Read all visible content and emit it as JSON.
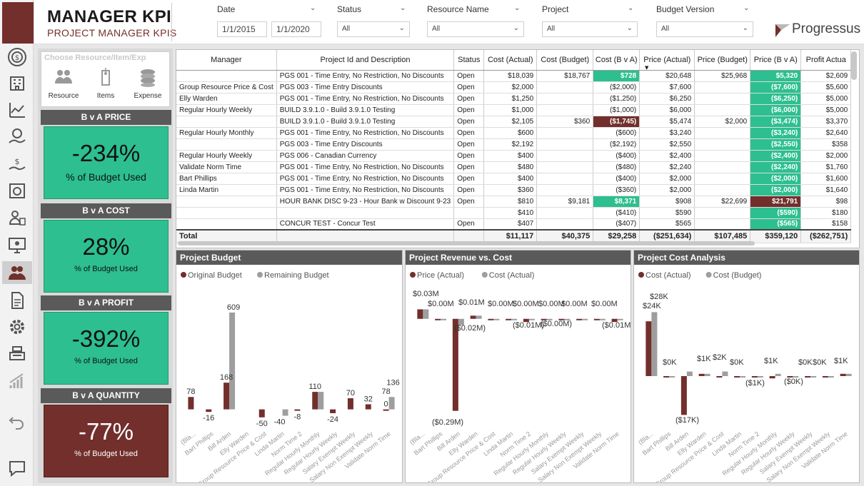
{
  "header": {
    "title": "MANAGER KPI",
    "subtitle": "PROJECT MANAGER KPIS",
    "logo_text": "Progressus"
  },
  "filters": {
    "date": {
      "label": "Date",
      "from": "1/1/2015",
      "to": "1/1/2020"
    },
    "status": {
      "label": "Status",
      "value": "All"
    },
    "resource": {
      "label": "Resource Name",
      "value": "All"
    },
    "project": {
      "label": "Project",
      "value": "All"
    },
    "budget_version": {
      "label": "Budget Version",
      "value": "All"
    }
  },
  "chooser": {
    "title": "Choose Resource/Item/Exp",
    "items": [
      {
        "label": "Resource",
        "icon": "people-icon"
      },
      {
        "label": "Items",
        "icon": "tag-icon"
      },
      {
        "label": "Expense",
        "icon": "coins-icon"
      }
    ]
  },
  "kpis": [
    {
      "title": "B v A PRICE",
      "value": "-234%",
      "caption": "% of Budget Used",
      "status": "green"
    },
    {
      "title": "B v A COST",
      "value": "28%",
      "caption": "% of Budget Used",
      "status": "green"
    },
    {
      "title": "B v A PROFIT",
      "value": "-392%",
      "caption": "% of Budget Used",
      "status": "green"
    },
    {
      "title": "B v A QUANTITY",
      "value": "-77%",
      "caption": "% of Budget Used",
      "status": "red"
    }
  ],
  "table": {
    "columns": [
      "Manager",
      "Project Id and Description",
      "Status",
      "Cost (Actual)",
      "Cost (Budget)",
      "Cost (B v A)",
      "Price (Actual)",
      "Price (Budget)",
      "Price (B v A)",
      "Profit Actua"
    ],
    "rows": [
      [
        "",
        "PGS 001 - Time Entry, No Restriction, No Discounts",
        "Open",
        "$18,039",
        "$18,767",
        "$728",
        "$20,648",
        "$25,968",
        "$5,320",
        "$2,609"
      ],
      [
        "Group Resource Price & Cost",
        "PGS 003 - Time Entry Discounts",
        "Open",
        "$2,000",
        "",
        "($2,000)",
        "$7,600",
        "",
        "($7,600)",
        "$5,600"
      ],
      [
        "Elly Warden",
        "PGS 001 - Time Entry, No Restriction, No Discounts",
        "Open",
        "$1,250",
        "",
        "($1,250)",
        "$6,250",
        "",
        "($6,250)",
        "$5,000"
      ],
      [
        "Regular Hourly Weekly",
        "BUILD 3.9.1.0 - Build 3.9.1.0 Testing",
        "Open",
        "$1,000",
        "",
        "($1,000)",
        "$6,000",
        "",
        "($6,000)",
        "$5,000"
      ],
      [
        "",
        "BUILD 3.9.1.0 - Build 3.9.1.0 Testing",
        "Open",
        "$2,105",
        "$360",
        "($1,745)",
        "$5,474",
        "$2,000",
        "($3,474)",
        "$3,370"
      ],
      [
        "Regular Hourly Monthly",
        "PGS 001 - Time Entry, No Restriction, No Discounts",
        "Open",
        "$600",
        "",
        "($600)",
        "$3,240",
        "",
        "($3,240)",
        "$2,640"
      ],
      [
        "",
        "PGS 003 - Time Entry Discounts",
        "Open",
        "$2,192",
        "",
        "($2,192)",
        "$2,550",
        "",
        "($2,550)",
        "$358"
      ],
      [
        "Regular Hourly Weekly",
        "PGS 006 - Canadian Currency",
        "Open",
        "$400",
        "",
        "($400)",
        "$2,400",
        "",
        "($2,400)",
        "$2,000"
      ],
      [
        "Validate Norm Time",
        "PGS 001 - Time Entry, No Restriction, No Discounts",
        "Open",
        "$480",
        "",
        "($480)",
        "$2,240",
        "",
        "($2,240)",
        "$1,760"
      ],
      [
        "Bart Phillips",
        "PGS 001 - Time Entry, No Restriction, No Discounts",
        "Open",
        "$400",
        "",
        "($400)",
        "$2,000",
        "",
        "($2,000)",
        "$1,600"
      ],
      [
        "Linda Martin",
        "PGS 001 - Time Entry, No Restriction, No Discounts",
        "Open",
        "$360",
        "",
        "($360)",
        "$2,000",
        "",
        "($2,000)",
        "$1,640"
      ],
      [
        "",
        "HOUR BANK DISC 9-23 - Hour Bank w Discount 9-23",
        "Open",
        "$810",
        "$9,181",
        "$8,371",
        "$908",
        "$22,699",
        "$21,791",
        "$98"
      ],
      [
        "",
        "",
        "",
        "$410",
        "",
        "($410)",
        "$590",
        "",
        "($590)",
        "$180"
      ],
      [
        "",
        "CONCUR TEST - Concur Test",
        "Open",
        "$407",
        "",
        "($407)",
        "$565",
        "",
        "($565)",
        "$158"
      ]
    ],
    "cell_status": [
      [
        "",
        "",
        "",
        "",
        "",
        "g",
        "",
        "",
        "g",
        ""
      ],
      [
        "",
        "",
        "",
        "",
        "",
        "",
        "",
        "",
        "g",
        ""
      ],
      [
        "",
        "",
        "",
        "",
        "",
        "",
        "",
        "",
        "g",
        ""
      ],
      [
        "",
        "",
        "",
        "",
        "",
        "",
        "",
        "",
        "g",
        ""
      ],
      [
        "",
        "",
        "",
        "",
        "",
        "r",
        "",
        "",
        "g",
        ""
      ],
      [
        "",
        "",
        "",
        "",
        "",
        "",
        "",
        "",
        "g",
        ""
      ],
      [
        "",
        "",
        "",
        "",
        "",
        "",
        "",
        "",
        "g",
        ""
      ],
      [
        "",
        "",
        "",
        "",
        "",
        "",
        "",
        "",
        "g",
        ""
      ],
      [
        "",
        "",
        "",
        "",
        "",
        "",
        "",
        "",
        "g",
        ""
      ],
      [
        "",
        "",
        "",
        "",
        "",
        "",
        "",
        "",
        "g",
        ""
      ],
      [
        "",
        "",
        "",
        "",
        "",
        "",
        "",
        "",
        "g",
        ""
      ],
      [
        "",
        "",
        "",
        "",
        "",
        "g",
        "",
        "",
        "r",
        ""
      ],
      [
        "",
        "",
        "",
        "",
        "",
        "",
        "",
        "",
        "g",
        ""
      ],
      [
        "",
        "",
        "",
        "",
        "",
        "",
        "",
        "",
        "g",
        ""
      ]
    ],
    "total": [
      "Total",
      "",
      "",
      "$11,117",
      "$40,375",
      "$29,258",
      "($251,634)",
      "$107,485",
      "$359,120",
      "($262,751)"
    ]
  },
  "colors": {
    "maroon": "#722f2c",
    "grey": "#9e9e9e",
    "green": "#2dbf8f",
    "header_grey": "#5a5a5a"
  },
  "chart_data": [
    {
      "type": "bar",
      "title": "Project Budget",
      "categories": [
        "(Bla...",
        "Bart Phillips",
        "Bill Arden",
        "Elly Warden",
        "Group Resource Price & Cost",
        "Linda Martin",
        "Norm Time 2",
        "Regular Hourly Monthly",
        "Regular Hourly Weekly",
        "Salary Exempt Weekly",
        "Salary Non Exempt Weekly",
        "Validate Norm Time"
      ],
      "series": [
        {
          "name": "Original Budget",
          "values": [
            78,
            -16,
            168,
            null,
            -50,
            null,
            -8,
            110,
            -24,
            70,
            32,
            0
          ]
        },
        {
          "name": "Remaining Budget",
          "values": [
            null,
            null,
            609,
            null,
            null,
            -40,
            null,
            110,
            null,
            null,
            null,
            78
          ]
        }
      ],
      "labels": [
        {
          "text": "78",
          "cat": 0,
          "v": 78
        },
        {
          "text": "-16",
          "cat": 1,
          "v": -16
        },
        {
          "text": "168",
          "cat": 2,
          "v": 168
        },
        {
          "text": "609",
          "cat": 2,
          "v": 609,
          "s": 1
        },
        {
          "text": "-50",
          "cat": 4,
          "v": -50
        },
        {
          "text": "-40",
          "cat": 5,
          "v": -40
        },
        {
          "text": "-8",
          "cat": 6,
          "v": -8
        },
        {
          "text": "110",
          "cat": 7,
          "v": 110
        },
        {
          "text": "-24",
          "cat": 8,
          "v": -24
        },
        {
          "text": "70",
          "cat": 9,
          "v": 70
        },
        {
          "text": "32",
          "cat": 10,
          "v": 32
        },
        {
          "text": "0",
          "cat": 11,
          "v": 0
        },
        {
          "text": "78",
          "cat": 11,
          "v": 78
        },
        {
          "text": "136",
          "cat": 11,
          "v": 136,
          "s": 1
        }
      ],
      "ylim": [
        -60,
        640
      ],
      "legend": "top-left"
    },
    {
      "type": "bar",
      "title": "Project Revenue vs. Cost",
      "categories": [
        "(Bla...",
        "Bart Phillips",
        "Bill Arden",
        "Elly Warden",
        "Group Resource Price & Cost",
        "Linda Martin",
        "Norm Time 2",
        "Regular Hourly Monthly",
        "Regular Hourly Weekly",
        "Salary Exempt Weekly",
        "Salary Non Exempt Weekly",
        "Validate Norm Time"
      ],
      "series": [
        {
          "name": "Price (Actual)",
          "values": [
            0.03,
            0.0,
            -0.29,
            0.01,
            0.0,
            0.0,
            -0.01,
            0.0,
            0.0,
            0.0,
            0.0,
            -0.01
          ]
        },
        {
          "name": "Cost (Actual)",
          "values": [
            0.03,
            0.0,
            -0.02,
            0.01,
            0.0,
            0.0,
            0.0,
            0.0,
            0.0,
            0.0,
            0.0,
            0.0
          ]
        }
      ],
      "labels": [
        "$0.03M",
        "$0.00M",
        "($0.29M)",
        "($0.02M)",
        "$0.01M",
        "$0.00M",
        "$0.00M",
        "($0.01M)",
        "$0.00M",
        "($0.00M)",
        "$0.00M",
        "$0.00M",
        "($0.01M)"
      ],
      "ylim": [
        -0.32,
        0.04
      ],
      "legend": "top-left"
    },
    {
      "type": "bar",
      "title": "Project Cost Analysis",
      "categories": [
        "(Bla...",
        "Bart Phillips",
        "Bill Arden",
        "Elly Warden",
        "Group Resource Price & Cost",
        "Linda Martin",
        "Norm Time 2",
        "Regular Hourly Monthly",
        "Regular Hourly Weekly",
        "Salary Exempt Weekly",
        "Salary Non Exempt Weekly",
        "Validate Norm Time"
      ],
      "series": [
        {
          "name": "Cost (Actual)",
          "values": [
            24,
            0,
            -17,
            1,
            0,
            0,
            0,
            -1,
            0,
            0,
            0,
            1
          ]
        },
        {
          "name": "Cost (Budget)",
          "values": [
            28,
            0,
            2,
            1,
            2,
            0,
            0,
            1,
            0,
            0,
            0,
            1
          ]
        }
      ],
      "labels": [
        "$24K",
        "$28K",
        "$0K",
        "($17K)",
        "$1K",
        "$2K",
        "$0K",
        "($1K)",
        "$1K",
        "($0K)",
        "$0K",
        "$0K",
        "$1K"
      ],
      "ylim": [
        -20,
        30
      ],
      "legend": "top-left"
    }
  ]
}
